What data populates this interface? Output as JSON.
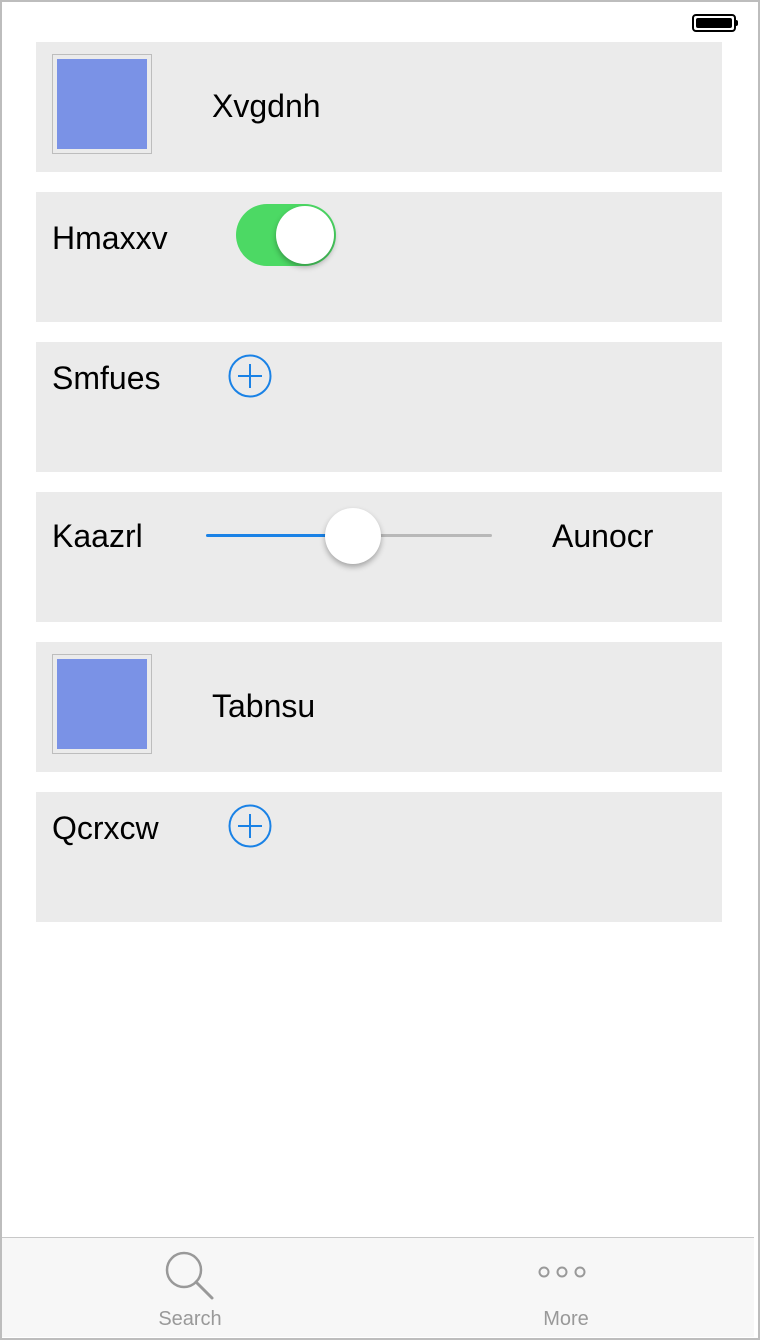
{
  "colors": {
    "row_background": "#ebebeb",
    "swatch": "#7a92e6",
    "toggle_on": "#4cd964",
    "tint": "#1a82e6",
    "slider_track": "#b8b8b8",
    "tab_inactive": "#999999"
  },
  "rows": [
    {
      "type": "image-cell",
      "label": "Xvgdnh"
    },
    {
      "type": "switch-cell",
      "label": "Hmaxxv",
      "on": true
    },
    {
      "type": "add-cell",
      "label": "Smfues",
      "icon": "plus-circle-icon"
    },
    {
      "type": "slider-cell",
      "label": "Kaazrl",
      "value_label": "Aunocr",
      "slider_fraction": 0.5
    },
    {
      "type": "image-cell",
      "label": "Tabnsu"
    },
    {
      "type": "add-cell",
      "label": "Qcrxcw",
      "icon": "plus-circle-icon"
    }
  ],
  "tab_bar": {
    "items": [
      {
        "label": "Search",
        "icon": "search-icon"
      },
      {
        "label": "More",
        "icon": "more-icon"
      }
    ]
  },
  "status_bar": {
    "battery_icon": "battery-icon",
    "battery_level": 1.0
  }
}
